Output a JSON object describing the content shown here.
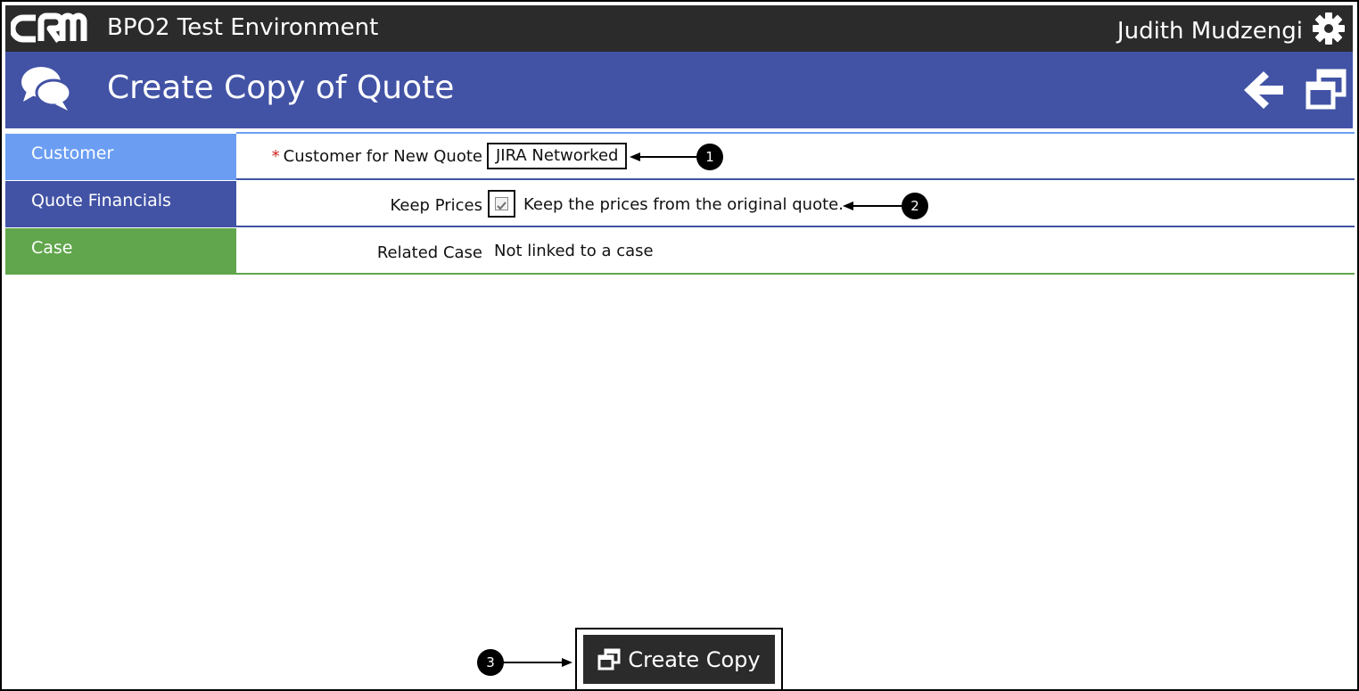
{
  "header": {
    "logo_text": "CRM",
    "environment": "BPO2 Test Environment",
    "user_name": "Judith Mudzengi"
  },
  "page": {
    "title": "Create Copy of Quote"
  },
  "sections": [
    {
      "label": "Customer",
      "color": "#6b9ef2"
    },
    {
      "label": "Quote Financials",
      "color": "#4253a5"
    },
    {
      "label": "Case",
      "color": "#61a64c"
    }
  ],
  "form": {
    "customer": {
      "required_mark": "*",
      "label": "Customer for New Quote",
      "value": "JIRA Networked"
    },
    "keep_prices": {
      "label": "Keep Prices",
      "checked": true,
      "description": "Keep the prices from the original quote."
    },
    "related_case": {
      "label": "Related Case",
      "value": "Not linked to a case"
    }
  },
  "actions": {
    "create_copy_label": "Create Copy"
  },
  "callouts": [
    "1",
    "2",
    "3"
  ],
  "colors": {
    "topbar": "#2b2b2b",
    "titleband": "#4253a5",
    "required": "#d21f1f"
  }
}
